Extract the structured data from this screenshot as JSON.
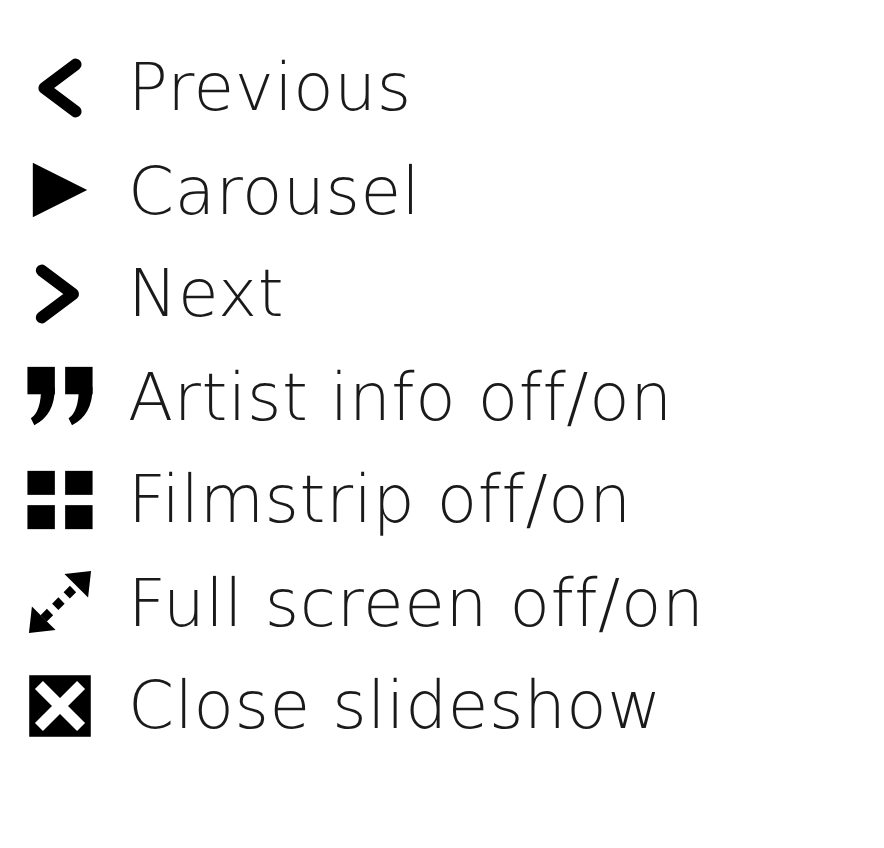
{
  "shortcuts": [
    {
      "kind": "previous",
      "label": "Previous"
    },
    {
      "kind": "carousel",
      "label": "Carousel"
    },
    {
      "kind": "next",
      "label": "Next"
    },
    {
      "kind": "artist-info",
      "label": "Artist info off/on"
    },
    {
      "kind": "filmstrip",
      "label": "Filmstrip off/on"
    },
    {
      "kind": "full-screen",
      "label": "Full screen off/on"
    },
    {
      "kind": "close",
      "label": "Close slideshow"
    }
  ]
}
